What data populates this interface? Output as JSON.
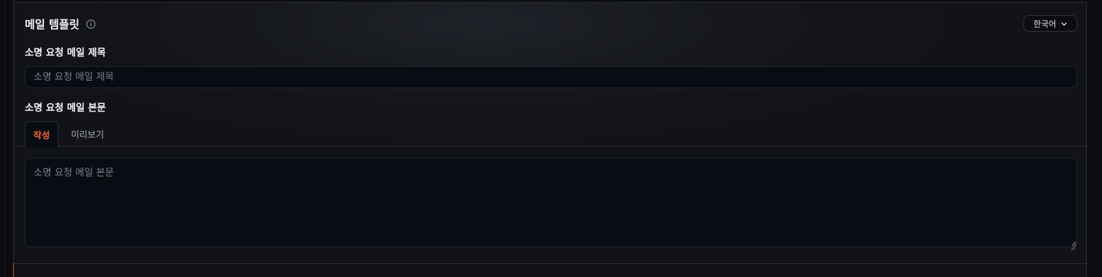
{
  "section": {
    "title": "메일 템플릿",
    "info_icon": "info-icon"
  },
  "language_select": {
    "value": "한국어",
    "icon": "chevron-down-icon"
  },
  "subject": {
    "label": "소명 요청 메일 제목",
    "placeholder": "소명 요청 메일 제목",
    "value": ""
  },
  "body": {
    "label": "소명 요청 메일 본문",
    "placeholder": "소명 요청 메일 본문",
    "value": ""
  },
  "tabs": [
    {
      "label": "작성",
      "active": true
    },
    {
      "label": "미리보기",
      "active": false
    }
  ],
  "colors": {
    "accent": "#ff6a33",
    "background": "#111319",
    "input_background": "#090c12",
    "border": "#2a2d35"
  }
}
